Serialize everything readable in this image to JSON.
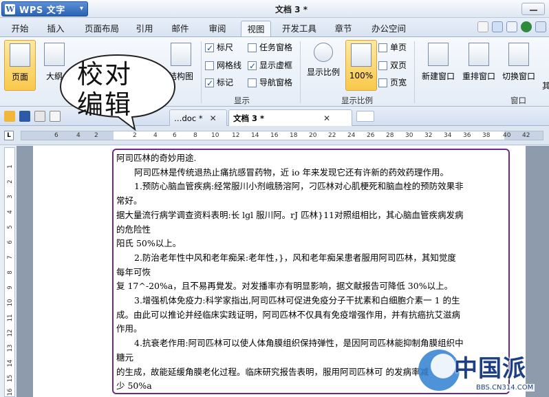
{
  "app": {
    "name": "WPS 文字",
    "logo_letter": "W",
    "menu_caret": "▾",
    "doc_title": "文档 3 *"
  },
  "tabs": [
    "开始",
    "插入",
    "页面布局",
    "引用",
    "邮件",
    "审阅",
    "视图",
    "开发工具",
    "章节",
    "办公空间"
  ],
  "ribbon": {
    "buttons": {
      "page": "页面",
      "outline": "大纲",
      "structure": "结构图",
      "show_ratio": "显示比例",
      "percent": "100%",
      "single": "单页",
      "double": "双页",
      "width": "页宽",
      "new_window": "新建窗口",
      "rearrange": "重排窗口",
      "switch_window": "切换窗口",
      "more": "其"
    },
    "checks": [
      {
        "label": "标尺",
        "checked": true
      },
      {
        "label": "网格线",
        "checked": false
      },
      {
        "label": "标记",
        "checked": true
      },
      {
        "label": "任务窗格",
        "checked": false
      },
      {
        "label": "显示虚框",
        "checked": true
      },
      {
        "label": "导航窗格",
        "checked": false
      }
    ],
    "groups": {
      "show": "显示",
      "ratio": "显示比例",
      "window": "窗口"
    }
  },
  "doc_tabs": [
    {
      "label": "…doc *",
      "active": false
    },
    {
      "label": "文档 3 *",
      "active": true
    }
  ],
  "ruler": {
    "ticks": [
      "6",
      "4",
      "2",
      "2",
      "4",
      "6",
      "8",
      "10",
      "12",
      "14",
      "16",
      "18",
      "20",
      "22",
      "24",
      "26",
      "28",
      "30",
      "32",
      "34",
      "36",
      "38",
      "40",
      "42"
    ],
    "corner": "L"
  },
  "vruler": {
    "ticks": [
      "1",
      "2",
      "3",
      "4",
      "5",
      "6",
      "7",
      "8",
      "9",
      "10",
      "11",
      "12",
      "13",
      "14",
      "15",
      "16"
    ]
  },
  "callout": {
    "line1": "校对",
    "line2": "编辑"
  },
  "document": {
    "lines": [
      {
        "text": "阿司匹林的奇妙用途.",
        "indent": false
      },
      {
        "text": "阿司匹林是传统退热止痛抗感冒药物，近 io 年来发现它还有许新的药效药理作用。",
        "indent": true
      },
      {
        "text": "1.预防心脑血管疾病:经常服川小剂峨肠溶阿，刁匹林对心肌梗死和脑血栓的预防效果非",
        "indent": true
      },
      {
        "text": "常好。",
        "indent": false
      },
      {
        "text": "据大量流行病学调查资料表明:长 lgl 服川阿。rJ 匹林}11对照组相比，其心脑血管疾病发病",
        "indent": false
      },
      {
        "text": "的危险性",
        "indent": false
      },
      {
        "text": "阳氏 50%以上。",
        "indent": false
      },
      {
        "text": "2.防治老年性中风和老年痴呆:老年性，}，风和老年痴呆患者服用阿司匹林，其知觉度",
        "indent": true
      },
      {
        "text": "每年可恢",
        "indent": false
      },
      {
        "text": "复 17^-20%a，且不易再覺发。对发播率亦有明显影响，据文献报告可降低 30%以上。",
        "indent": false
      },
      {
        "text": "3.增强机体免疫力:科学家指出,阿司匹林可促进免疫分子干扰素和白细胞介素一 1 的生",
        "indent": true
      },
      {
        "text": "成。由此可以推论并经临床实践证明，阿司匹林不仅具有免疫增强作用，并有抗癌抗艾滋病",
        "indent": false
      },
      {
        "text": "作用。",
        "indent": false
      },
      {
        "text": "4.抗衰老作用:阿司匹林可以使人体角膜组织保持弹性，是因阿司匹林能抑制角膜组织中",
        "indent": true
      },
      {
        "text": "糖元",
        "indent": false
      },
      {
        "text": "的生成，故能延缓角膜老化过程。临床研究报告表明，服用阿司匹林可   的发病率减",
        "indent": false
      },
      {
        "text": "少 50%a",
        "indent": false
      }
    ]
  },
  "watermark": {
    "brand": "中国派",
    "url": "BBS.CN314.COM"
  }
}
